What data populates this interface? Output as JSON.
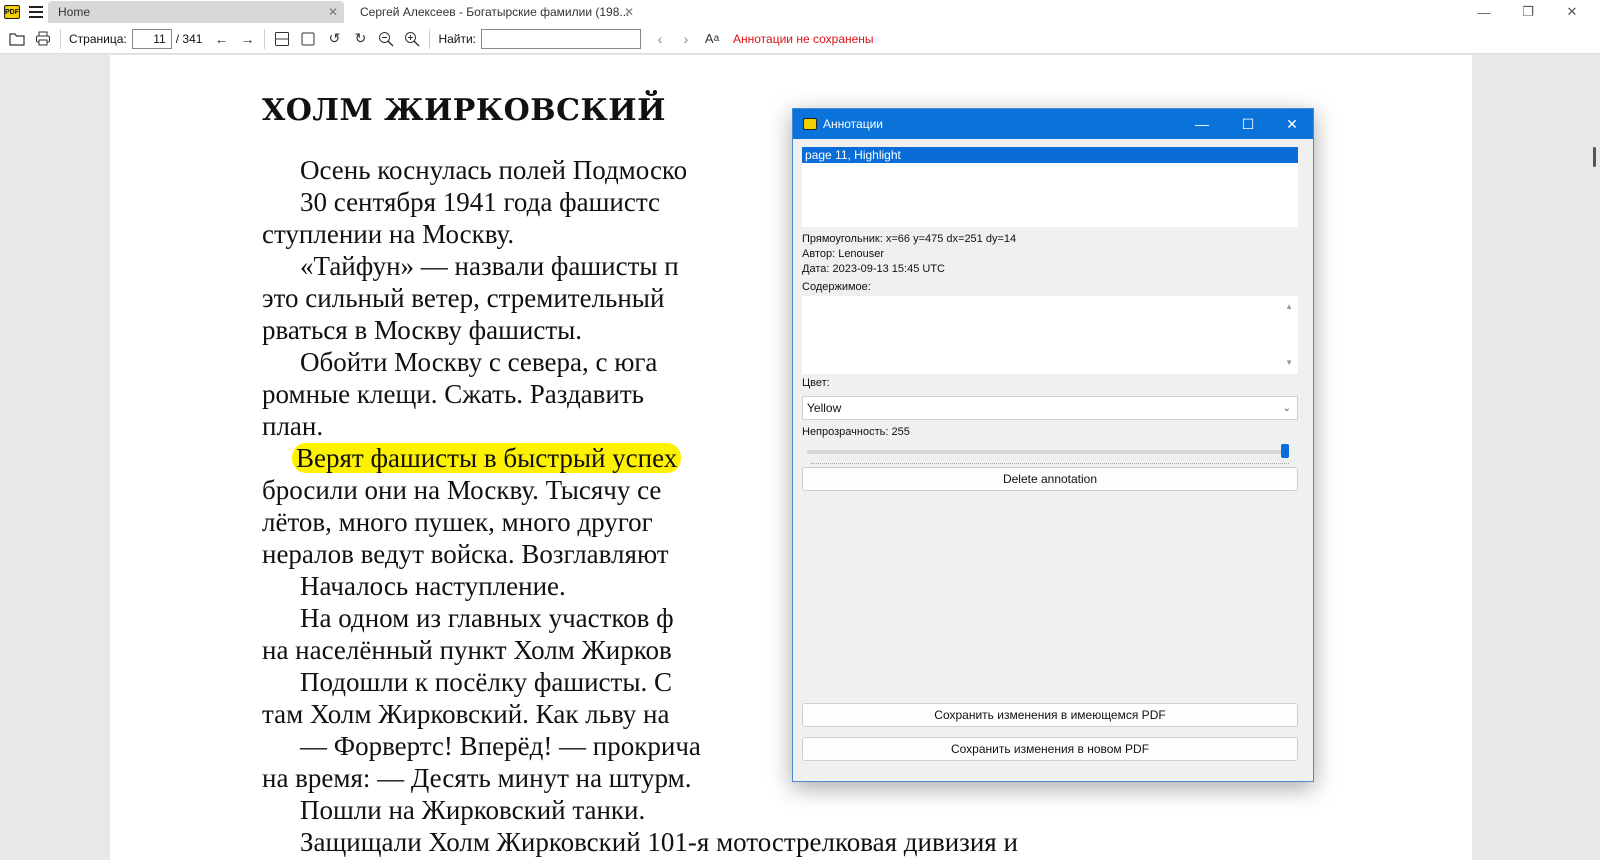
{
  "tabs": {
    "home": "Home",
    "document": "Сергей Алексеев - Богатырские фамилии (198..."
  },
  "toolbar": {
    "page_label": "Страница:",
    "page_value": "11",
    "page_total": "/ 341",
    "find_label": "Найти:",
    "find_value": "",
    "unsaved": "Аннотации не сохранены"
  },
  "document": {
    "heading": "ХОЛМ ЖИРКОВСКИЙ",
    "lines": [
      "Осень коснулась полей Подмоско",
      "30 сентября 1941 года фашистс",
      "ступлении на Москву.",
      "«Тайфун» — назвали фашисты п",
      "это сильный ветер, стремительный",
      "рваться в Москву фашисты.",
      "Обойти Москву с севера, с юга",
      "ромные клещи. Сжать. Раздавить",
      "план.",
      "Верят фашисты в быстрый успех",
      "бросили они на Москву. Тысячу се",
      "лётов, много пушек, много другог",
      "нералов ведут войска. Возглавляют",
      "Началось наступление.",
      "На одном из главных участков ф",
      "на населённый пункт Холм Жирков",
      "Подошли к посёлку фашисты. С",
      "там Холм Жирковский. Как льву на",
      "— Форвертс! Вперёд! — прокрича",
      "на время: — Десять минут на штурм.",
      "Пошли на Жирковский танки.",
      "Защищали Холм Жирковский 101-я мотострелковая дивизия и"
    ]
  },
  "dialog": {
    "title": "Аннотации",
    "selected_item": "page 11, Highlight",
    "rect": "Прямоугольник: x=66 y=475 dx=251 dy=14",
    "author": "Автор: Lenouser",
    "date": "Дата: 2023-09-13 15:45 UTC",
    "content_label": "Содержимое:",
    "content_value": "",
    "color_label": "Цвет:",
    "color_value": "Yellow",
    "opacity_label": "Непрозрачность: 255",
    "opacity_level": 1.0,
    "delete_button": "Delete annotation",
    "save_existing": "Сохранить изменения в имеющемся PDF",
    "save_new": "Сохранить изменения в новом PDF"
  },
  "colors": {
    "accent": "#0a73d9",
    "highlight": "#fff200",
    "unsaved": "#dd1111"
  }
}
